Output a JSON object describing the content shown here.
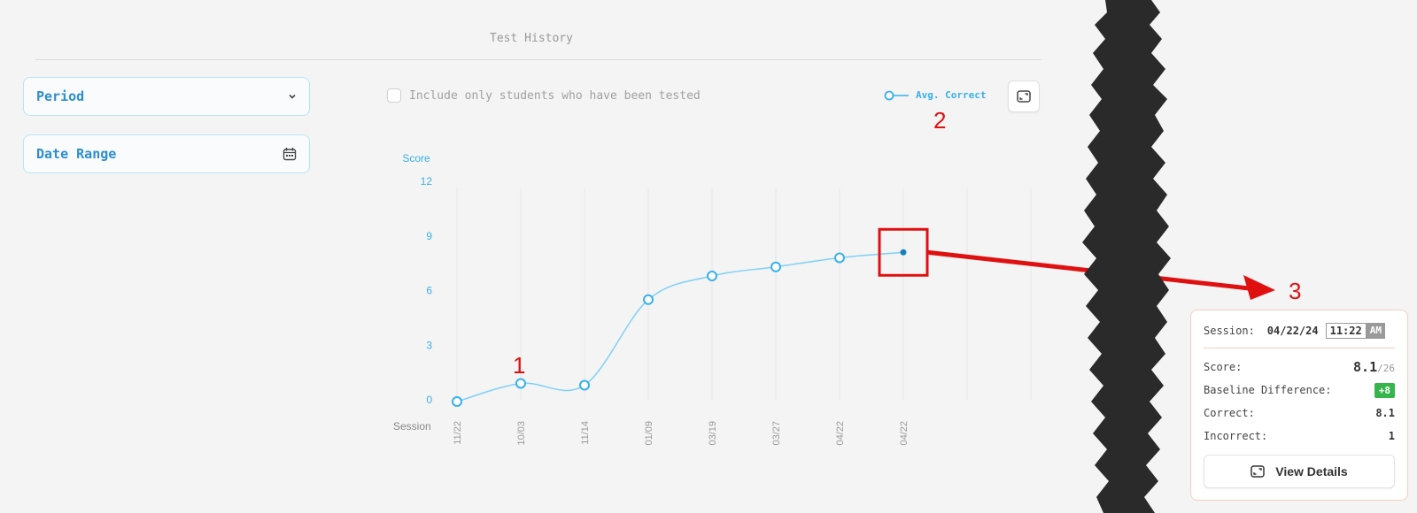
{
  "header": {
    "title": "Test History"
  },
  "filters": {
    "period_label": "Period",
    "date_range_label": "Date Range",
    "checkbox_label": "Include only students who have been tested",
    "checkbox_checked": false
  },
  "legend": {
    "label": "Avg. Correct",
    "icon": "line-circle-icon",
    "color": "#38b0ec"
  },
  "annotations": {
    "one": "1",
    "two": "2",
    "three": "3"
  },
  "chart_data": {
    "type": "line",
    "title": "",
    "xlabel": "Session",
    "ylabel": "Score",
    "categories": [
      "11/22",
      "10/03",
      "11/14",
      "01/09",
      "03/19",
      "03/27",
      "04/22",
      "04/22"
    ],
    "series": [
      {
        "name": "Avg. Correct",
        "values": [
          -0.1,
          0.9,
          0.8,
          5.5,
          6.8,
          7.3,
          7.8,
          8.1
        ]
      }
    ],
    "yticks": [
      0,
      3,
      6,
      9,
      12
    ],
    "ylim": [
      0,
      12
    ],
    "grid": "vertical",
    "legend_position": "top-right",
    "highlighted_point": "04/22 (last)",
    "colors": {
      "line": "#7fd0f7",
      "axis_text": "#38b0ec",
      "highlight": "#1a7fbf"
    }
  },
  "tooltip": {
    "session_label": "Session:",
    "session_date": "04/22/24",
    "session_time": "11:22",
    "session_ampm": "AM",
    "score_label": "Score:",
    "score_value": "8.1",
    "score_total": "/26",
    "baseline_label": "Baseline Difference:",
    "baseline_value": "+8",
    "correct_label": "Correct:",
    "correct_value": "8.1",
    "incorrect_label": "Incorrect:",
    "incorrect_value": "1",
    "button_label": "View Details"
  },
  "colors": {
    "annotation": "#e01010",
    "accent": "#2b8fd1",
    "positive": "#36b54a"
  }
}
